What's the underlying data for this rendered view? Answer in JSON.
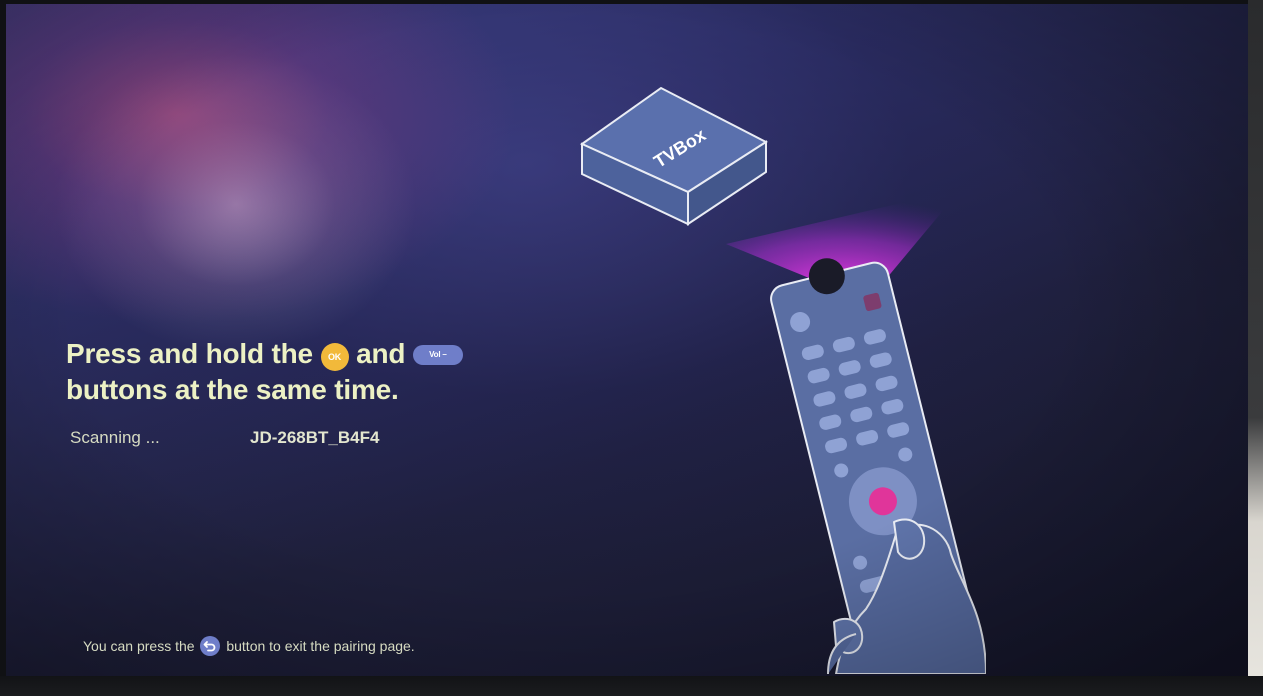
{
  "screen": {
    "instruction_part1": "Press and hold the",
    "ok_button_label": "OK",
    "instruction_and": "and",
    "vol_button_label": "Vol –",
    "instruction_part2": "buttons at the same time.",
    "scan_status": "Scanning ...",
    "device_name": "JD-268BT_B4F4",
    "hint_prefix": "You can press the",
    "hint_suffix": "button to exit the pairing page.",
    "tvbox_label": "TVBox"
  },
  "icons": {
    "back": "back-arrow-icon",
    "ok": "ok-button-icon",
    "vol": "vol-down-button-icon"
  },
  "colors": {
    "title_text": "#ecf1c4",
    "ok_badge": "#f2b93a",
    "vol_badge": "#6f7ec9",
    "remote_fill": "#5a6ea3",
    "signal_glow": "#d63ce8",
    "button_highlight": "#e0359a"
  }
}
